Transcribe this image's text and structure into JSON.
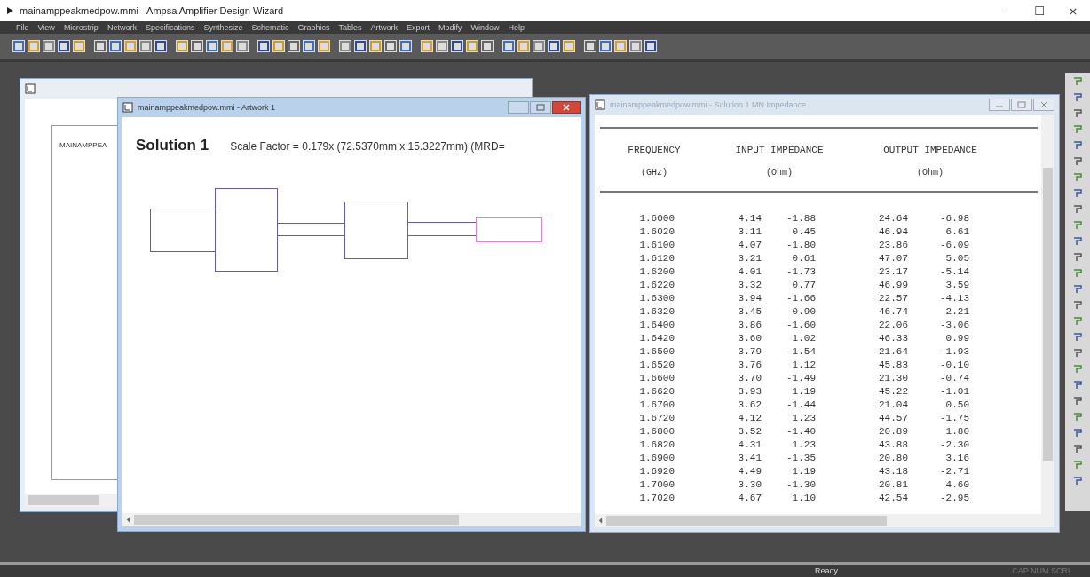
{
  "window": {
    "title": "mainamppeakmedpow.mmi - Ampsa Amplifier Design Wizard",
    "controls": [
      "–",
      "☐",
      "×"
    ]
  },
  "menu": [
    "File",
    "View",
    "Microstrip",
    "Network",
    "Specifications",
    "Synthesize",
    "Schematic",
    "Graphics",
    "Tables",
    "Artwork",
    "Export",
    "Modify",
    "Window",
    "Help"
  ],
  "back_window": {
    "page_heading": "MAINAMPPEA"
  },
  "artwork_window": {
    "title": "mainamppeakmedpow.mmi - Artwork 1",
    "heading": "Solution 1",
    "scale": "Scale Factor =  0.179x (72.5370mm x 15.3227mm)  (MRD="
  },
  "table_window": {
    "title": "mainamppeakmedpow.mmi - Solution 1 MN Impedance",
    "headers": [
      [
        "FREQUENCY",
        "(GHz)"
      ],
      [
        "INPUT IMPEDANCE",
        "(Ohm)"
      ],
      [
        "OUTPUT IMPEDANCE",
        "(Ohm)"
      ]
    ],
    "rows": [
      [
        "1.6000",
        "4.14",
        "-1.88",
        "24.64",
        "-6.98"
      ],
      [
        "1.6020",
        "3.11",
        "0.45",
        "46.94",
        "6.61"
      ],
      [
        "1.6100",
        "4.07",
        "-1.80",
        "23.86",
        "-6.09"
      ],
      [
        "1.6120",
        "3.21",
        "0.61",
        "47.07",
        "5.05"
      ],
      [
        "1.6200",
        "4.01",
        "-1.73",
        "23.17",
        "-5.14"
      ],
      [
        "1.6220",
        "3.32",
        "0.77",
        "46.99",
        "3.59"
      ],
      [
        "1.6300",
        "3.94",
        "-1.66",
        "22.57",
        "-4.13"
      ],
      [
        "1.6320",
        "3.45",
        "0.90",
        "46.74",
        "2.21"
      ],
      [
        "1.6400",
        "3.86",
        "-1.60",
        "22.06",
        "-3.06"
      ],
      [
        "1.6420",
        "3.60",
        "1.02",
        "46.33",
        "0.99"
      ],
      [
        "1.6500",
        "3.79",
        "-1.54",
        "21.64",
        "-1.93"
      ],
      [
        "1.6520",
        "3.76",
        "1.12",
        "45.83",
        "-0.10"
      ],
      [
        "1.6600",
        "3.70",
        "-1.49",
        "21.30",
        "-0.74"
      ],
      [
        "1.6620",
        "3.93",
        "1.19",
        "45.22",
        "-1.01"
      ],
      [
        "1.6700",
        "3.62",
        "-1.44",
        "21.04",
        "0.50"
      ],
      [
        "1.6720",
        "4.12",
        "1.23",
        "44.57",
        "-1.75"
      ],
      [
        "1.6800",
        "3.52",
        "-1.40",
        "20.89",
        "1.80"
      ],
      [
        "1.6820",
        "4.31",
        "1.23",
        "43.88",
        "-2.30"
      ],
      [
        "1.6900",
        "3.41",
        "-1.35",
        "20.80",
        "3.16"
      ],
      [
        "1.6920",
        "4.49",
        "1.19",
        "43.18",
        "-2.71"
      ],
      [
        "1.7000",
        "3.30",
        "-1.30",
        "20.81",
        "4.60"
      ],
      [
        "1.7020",
        "4.67",
        "1.10",
        "42.54",
        "-2.95"
      ]
    ]
  },
  "status_bar": {
    "message": "Ready",
    "indicators": "CAP NUM SCRL"
  }
}
